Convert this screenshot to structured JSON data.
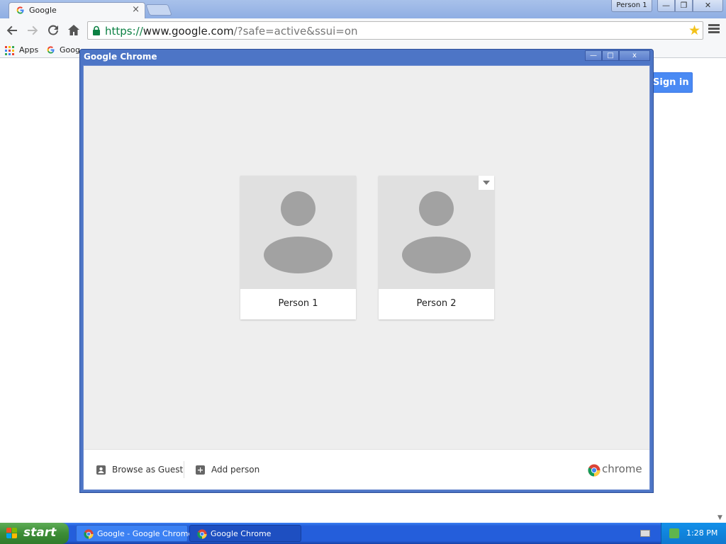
{
  "browser": {
    "tab": {
      "title": "Google",
      "close": "×"
    },
    "profile_button": "Person 1",
    "window_controls": {
      "minimize": "—",
      "maximize": "❐",
      "close": "✕"
    },
    "omnibox": {
      "scheme": "https://",
      "host": "www.google.com",
      "path": "/?safe=active&ssui=on"
    },
    "bookmarks": [
      {
        "label": "Apps",
        "icon": "apps-grid-icon"
      },
      {
        "label": "Google",
        "icon": "google-icon"
      }
    ]
  },
  "page": {
    "sign_in": "Sign in"
  },
  "dialog": {
    "title": "Google Chrome",
    "controls": {
      "minimize": "—",
      "maximize": "□",
      "close": "x"
    },
    "profiles": [
      {
        "name": "Person 1",
        "icon": "default-avatar-icon"
      },
      {
        "name": "Person 2",
        "icon": "default-avatar-icon"
      }
    ],
    "footer": {
      "guest": "Browse as Guest",
      "add_person": "Add person",
      "wordmark": "chrome"
    }
  },
  "taskbar": {
    "start": "start",
    "tasks": [
      {
        "label": "Google - Google Chrome",
        "icon": "chrome-icon"
      },
      {
        "label": "Google Chrome",
        "icon": "chrome-icon"
      }
    ],
    "clock": "1:28 PM"
  },
  "colors": {
    "signin_blue": "#4a8af4",
    "dialog_frame": "#4d75c6",
    "taskbar_blue": "#245edb",
    "start_green": "#3c8d36"
  }
}
